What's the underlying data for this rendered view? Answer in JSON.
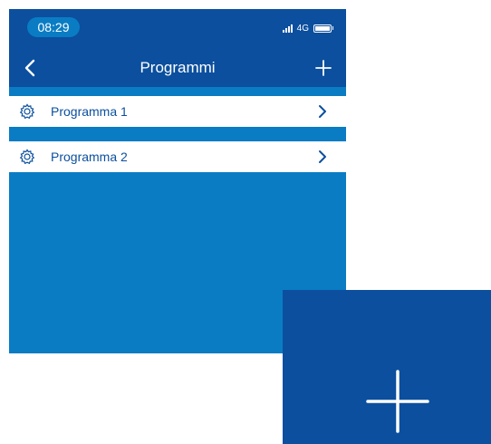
{
  "status_bar": {
    "time": "08:29",
    "network": "4G"
  },
  "nav": {
    "back_icon": "chevron-left-icon",
    "title": "Programmi",
    "add_icon": "plus-icon"
  },
  "programs": [
    {
      "label": "Programma 1",
      "icon": "gear-icon"
    },
    {
      "label": "Programma 2",
      "icon": "gear-icon"
    }
  ],
  "zoom": {
    "icon": "plus-icon"
  },
  "colors": {
    "header_blue": "#0b4f9e",
    "background_blue": "#0a7cc4",
    "row_text": "#0b4f9e"
  }
}
